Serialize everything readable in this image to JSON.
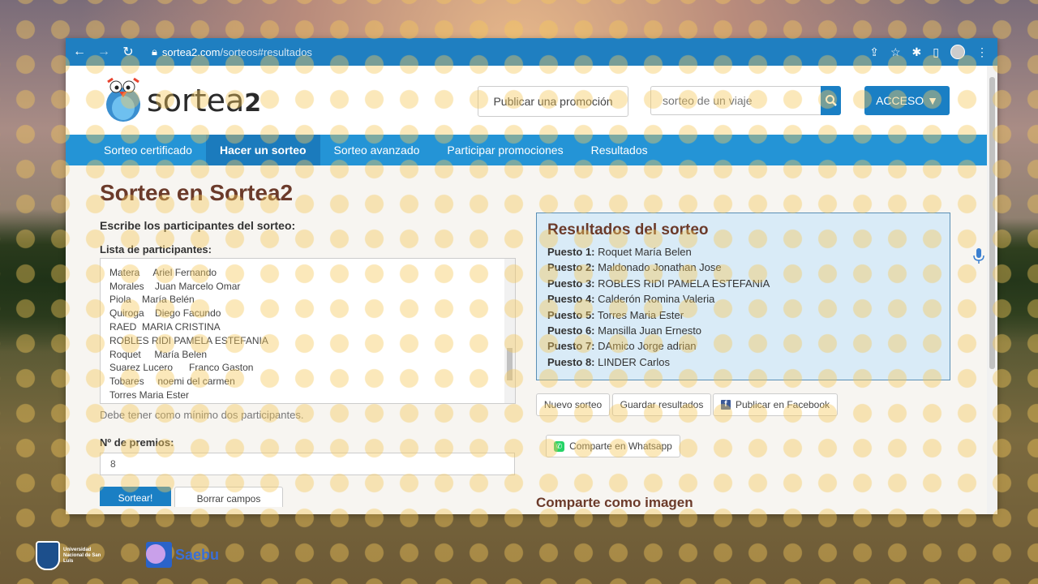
{
  "browser": {
    "url_domain": "sortea2.com",
    "url_path": "/sorteos#resultados"
  },
  "header": {
    "logo_text": "sortea",
    "logo_suffix": "2",
    "publicar_label": "Publicar una promoción",
    "search_placeholder": "sorteo de un viaje",
    "acceso_label": "ACCESO ▼"
  },
  "nav": {
    "items": [
      "Sorteo certificado",
      "Hacer un sorteo",
      "Sorteo avanzado",
      "Participar promociones",
      "Resultados"
    ],
    "active": "Hacer un sorteo"
  },
  "form": {
    "title": "Sortee en Sortea2",
    "escribe_label": "Escribe los participantes del sorteo:",
    "lista_label": "Lista de participantes:",
    "participants": [
      "Matera     Ariel Fernando",
      "Morales    Juan Marcelo Omar",
      "Piola    María Belén",
      "Quiroga    Diego Facundo",
      "RAED  MARIA CRISTINA",
      "ROBLES RIDI PAMELA ESTEFANIA",
      "Roquet     María Belen",
      "Suarez Lucero      Franco Gaston",
      "Tobares     noemi del carmen",
      "Torres Maria Ester"
    ],
    "hint": "Debe tener como mínimo dos participantes.",
    "premios_label": "Nº de premios:",
    "premios_value": "8",
    "sortear_label": "Sortear!",
    "borrar_label": "Borrar campos"
  },
  "results": {
    "title": "Resultados del sorteo",
    "rows": [
      {
        "label": "Puesto 1:",
        "name": "Roquet María Belen"
      },
      {
        "label": "Puesto 2:",
        "name": "Maldonado Jonathan Jose"
      },
      {
        "label": "Puesto 3:",
        "name": "ROBLES RIDI PAMELA ESTEFANIA"
      },
      {
        "label": "Puesto 4:",
        "name": "Calderón Romina Valeria"
      },
      {
        "label": "Puesto 5:",
        "name": "Torres Maria Ester"
      },
      {
        "label": "Puesto 6:",
        "name": "Mansilla Juan Ernesto"
      },
      {
        "label": "Puesto 7:",
        "name": "DAmico Jorge adrian"
      },
      {
        "label": "Puesto 8:",
        "name": "LINDER Carlos"
      }
    ],
    "nuevo_label": "Nuevo sorteo",
    "guardar_label": "Guardar resultados",
    "facebook_label": "Publicar en Facebook",
    "whatsapp_label": "Comparte en Whatsapp",
    "comparte_imagen": "Comparte como imagen"
  },
  "overlay": {
    "unsl_text": "Universidad Nacional de San Luis",
    "saebu_text": "Saebu"
  }
}
